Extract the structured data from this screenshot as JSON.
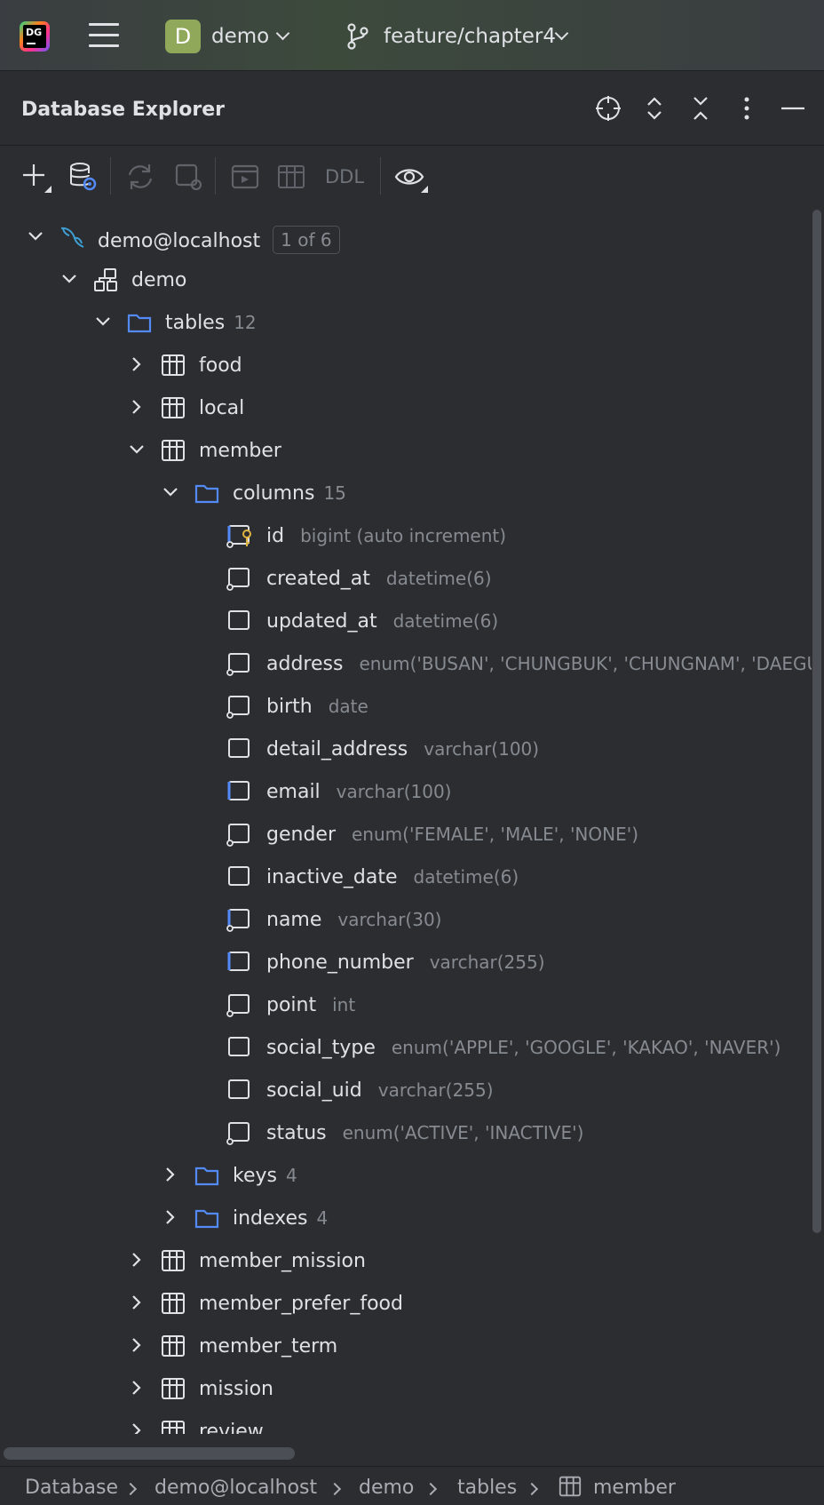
{
  "titlebar": {
    "logo_text": "DG",
    "project_initial": "D",
    "project_name": "demo",
    "branch_name": "feature/chapter4"
  },
  "panel": {
    "title": "Database Explorer",
    "toolbar": {
      "ddl_label": "DDL"
    }
  },
  "tree": {
    "datasource": {
      "label": "demo@localhost",
      "badge": "1 of 6"
    },
    "schema": {
      "label": "demo"
    },
    "tables_folder": {
      "label": "tables",
      "count": "12"
    },
    "tables_before": [
      {
        "label": "food"
      },
      {
        "label": "local"
      }
    ],
    "member": {
      "label": "member",
      "columns_folder": {
        "label": "columns",
        "count": "15"
      },
      "columns": [
        {
          "name": "id",
          "type": "bigint (auto increment)",
          "kind": "pk"
        },
        {
          "name": "created_at",
          "type": "datetime(6)",
          "kind": "notnull"
        },
        {
          "name": "updated_at",
          "type": "datetime(6)",
          "kind": "plain"
        },
        {
          "name": "address",
          "type": "enum('BUSAN', 'CHUNGBUK', 'CHUNGNAM', 'DAEGU",
          "kind": "notnull"
        },
        {
          "name": "birth",
          "type": "date",
          "kind": "notnull"
        },
        {
          "name": "detail_address",
          "type": "varchar(100)",
          "kind": "plain"
        },
        {
          "name": "email",
          "type": "varchar(100)",
          "kind": "indexed"
        },
        {
          "name": "gender",
          "type": "enum('FEMALE', 'MALE', 'NONE')",
          "kind": "notnull"
        },
        {
          "name": "inactive_date",
          "type": "datetime(6)",
          "kind": "plain"
        },
        {
          "name": "name",
          "type": "varchar(30)",
          "kind": "indexed-notnull"
        },
        {
          "name": "phone_number",
          "type": "varchar(255)",
          "kind": "indexed"
        },
        {
          "name": "point",
          "type": "int",
          "kind": "notnull"
        },
        {
          "name": "social_type",
          "type": "enum('APPLE', 'GOOGLE', 'KAKAO', 'NAVER')",
          "kind": "plain"
        },
        {
          "name": "social_uid",
          "type": "varchar(255)",
          "kind": "plain"
        },
        {
          "name": "status",
          "type": "enum('ACTIVE', 'INACTIVE')",
          "kind": "notnull"
        }
      ],
      "keys_folder": {
        "label": "keys",
        "count": "4"
      },
      "indexes_folder": {
        "label": "indexes",
        "count": "4"
      }
    },
    "tables_after": [
      {
        "label": "member_mission"
      },
      {
        "label": "member_prefer_food"
      },
      {
        "label": "member_term"
      },
      {
        "label": "mission"
      },
      {
        "label": "review"
      }
    ]
  },
  "breadcrumb": [
    "Database",
    "demo@localhost",
    "demo",
    "tables",
    "member"
  ],
  "colors": {
    "background": "#2b2d30",
    "text": "#dfe1e5",
    "muted": "#868a91",
    "folder_blue": "#548af7",
    "key_yellow": "#e0b440",
    "project_badge": "#8fa85a"
  }
}
